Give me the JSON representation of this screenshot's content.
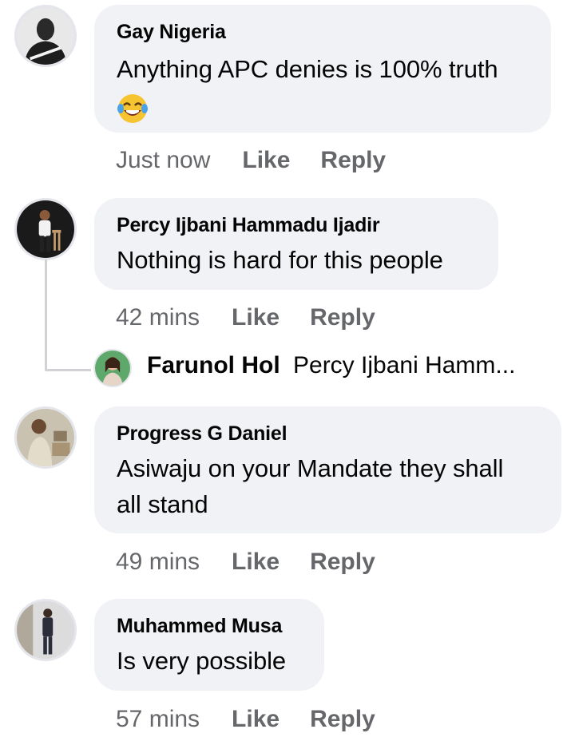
{
  "comments": [
    {
      "author": "Gay Nigeria",
      "text_lines": [
        "Anything APC denies is 100% truth"
      ],
      "emoji": "laughing-tears-emoji",
      "time": "Just now",
      "like": "Like",
      "reply": "Reply"
    },
    {
      "author": "Percy Ijbani Hammadu Ijadir",
      "text_lines": [
        "Nothing is hard for this people"
      ],
      "time": "42 mins",
      "like": "Like",
      "reply": "Reply",
      "replies": [
        {
          "author": "Farunol Hol",
          "preview": "Percy Ijbani Hamm..."
        }
      ]
    },
    {
      "author": "Progress G Daniel",
      "text_lines": [
        "Asiwaju on your Mandate they shall",
        "all stand"
      ],
      "time": "49 mins",
      "like": "Like",
      "reply": "Reply"
    },
    {
      "author": "Muhammed Musa",
      "text_lines": [
        "Is very possible"
      ],
      "time": "57 mins",
      "like": "Like",
      "reply": "Reply"
    }
  ],
  "colors": {
    "bubble": "#f0f2f5",
    "meta_text": "#65676b",
    "primary_text": "#050505"
  }
}
